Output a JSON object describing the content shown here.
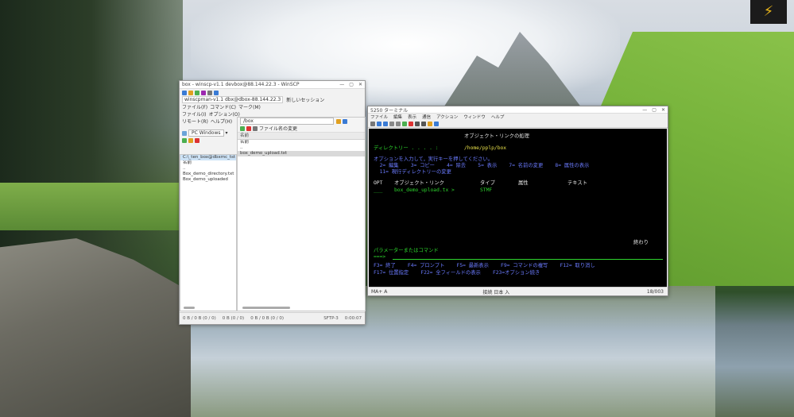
{
  "desktop": {
    "logo_glyph": "⚡"
  },
  "ftp": {
    "title": "box - winscp-v1.1 devbox@88.144.22.3 - WinSCP",
    "session_tab": "winscpman-v1.1 dbx@dbox-88.144.22.3",
    "new_session": "新しいセッション",
    "left_menu": [
      "ファイル(F)",
      "コマンド(C)",
      "マーク(M)",
      "ファイル(I)",
      "オプション(O)",
      "リモート(R)",
      "ヘルプ(H)"
    ],
    "left_drive": "PC Windows",
    "left_path": "",
    "left_header": "名前",
    "left_items": [
      "C:\\_ten_box@dbxmc_tst",
      "名前",
      "..",
      "Box_demo_directory.txt",
      "Box_demo_uploaded"
    ],
    "right_path": "/box",
    "right_toolbar": "ファイル名の変更",
    "right_header": "名前",
    "right_items": [
      "名前",
      "..",
      "box_demo_upload.txt"
    ],
    "status_left": [
      "0 B / 0 B (0 / 0)",
      "0 B (0 / 0)"
    ],
    "status_right": [
      "0 B / 0 B (0 / 0)",
      "0 B (0 / 0)",
      "SFTP-3",
      "0:00:07"
    ]
  },
  "terminal": {
    "title": "5250 ターミナル",
    "menu": [
      "ファイル",
      "編集",
      "表示",
      "通信",
      "アクション",
      "ウィンドウ",
      "ヘルプ"
    ],
    "screen_title": "オブジェクト・リンクの処理",
    "dir_label": "ディレクトリー . . . . :",
    "dir_value": "/home/pplp/box",
    "instr1": "オプションを入力して，実行キーを押してください。",
    "instr2": "  2= 編集    3= コピー    4= 除去    5= 表示    7= 名前の変更    8= 属性の表示",
    "instr3": "  11= 現行ディレクトリーの変更",
    "col_opt": "OPT",
    "col_link": "オブジェクト・リンク",
    "col_type": "タイプ",
    "col_attr": "属性",
    "col_text": "テキスト",
    "row_opt": "___",
    "row_name": "box_demo_upload.tx >",
    "row_type": "STMF",
    "end_label": "終わり",
    "param_label": "パラメーターまたはコマンド",
    "prompt": "===>",
    "fkeys1": "F3= 終了    F4= プロンプト    F5= 最新表示    F9= コマンドの複写    F12= 取り消し",
    "fkeys2": "F17= 位置指定    F22= 全フィールドの表示    F23=オプション続き",
    "status_left": "MA+   A",
    "status_mid": "接続   日本   入",
    "status_right": "18/003"
  }
}
